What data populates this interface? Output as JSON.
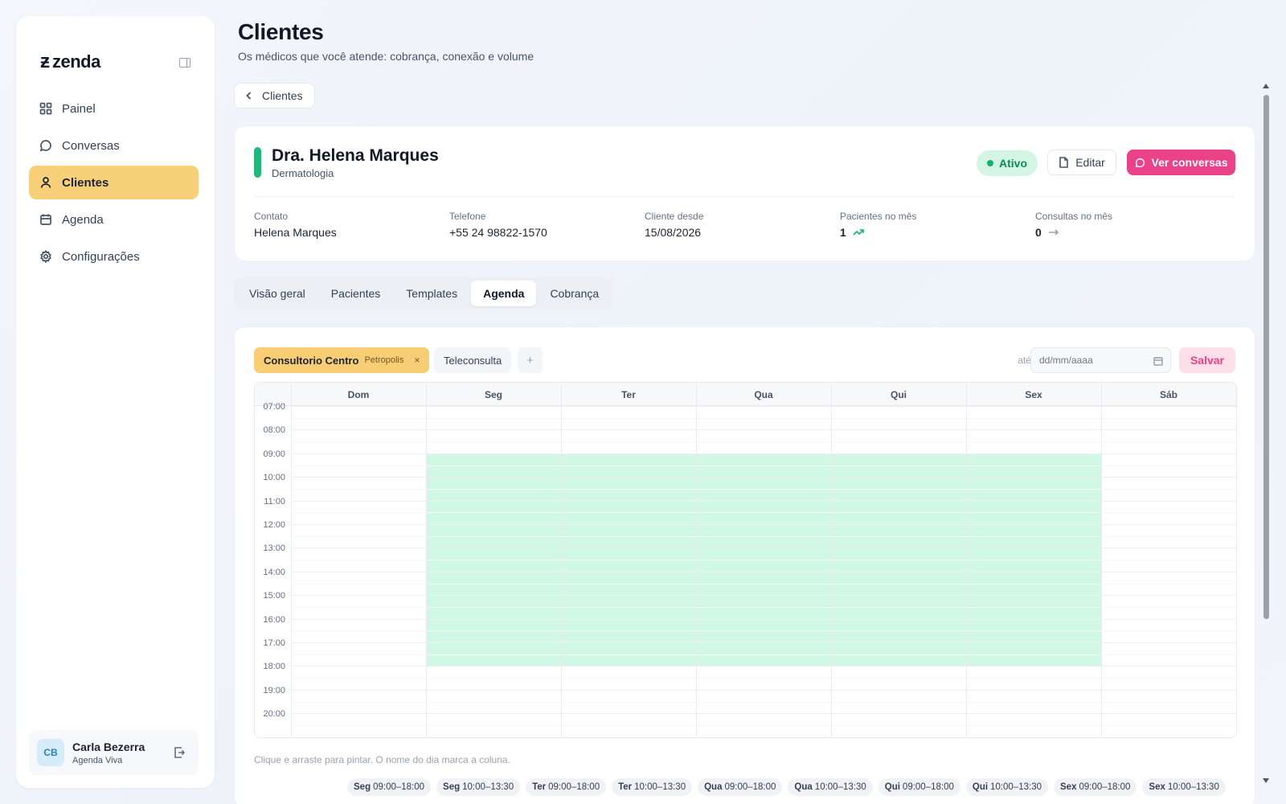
{
  "app": {
    "logo_text": "zenda"
  },
  "sidebar": {
    "items": [
      {
        "label": "Painel",
        "icon": "grid-icon"
      },
      {
        "label": "Conversas",
        "icon": "chat-icon"
      },
      {
        "label": "Clientes",
        "icon": "user-icon",
        "active": true
      },
      {
        "label": "Agenda",
        "icon": "calendar-icon"
      },
      {
        "label": "Configurações",
        "icon": "gear-icon"
      }
    ],
    "user": {
      "initials": "CB",
      "name": "Carla Bezerra",
      "subtitle": "Agenda Viva"
    }
  },
  "header": {
    "title": "Clientes",
    "subtitle": "Os médicos que você atende: cobrança, conexão e volume",
    "back_label": "Clientes"
  },
  "client": {
    "name": "Dra. Helena Marques",
    "specialty": "Dermatologia",
    "status": "Ativo",
    "edit_label": "Editar",
    "conversations_label": "Ver conversas",
    "accent_color": "#20b97b",
    "stats": [
      {
        "label": "Contato",
        "value": "Helena Marques"
      },
      {
        "label": "Telefone",
        "value": "+55 24 98822-1570"
      },
      {
        "label": "Cliente desde",
        "value": "15/08/2026"
      },
      {
        "label": "Pacientes no mês",
        "value": "1",
        "trend": "up"
      },
      {
        "label": "Consultas no mês",
        "value": "0",
        "trend": "flat"
      }
    ]
  },
  "tabs": [
    {
      "label": "Visão geral"
    },
    {
      "label": "Pacientes"
    },
    {
      "label": "Templates"
    },
    {
      "label": "Agenda",
      "active": true
    },
    {
      "label": "Cobrança"
    }
  ],
  "agenda": {
    "locations": [
      {
        "name": "Consultorio Centro",
        "city": "Petropolis",
        "active": true,
        "remove": "×"
      },
      {
        "name": "Teleconsulta"
      }
    ],
    "add_label": "+",
    "until_label": "até",
    "date_placeholder": "dd/mm/aaaa",
    "save_label": "Salvar",
    "days": [
      "Dom",
      "Seg",
      "Ter",
      "Qua",
      "Qui",
      "Sex",
      "Sáb"
    ],
    "hours": [
      "07:00",
      "08:00",
      "09:00",
      "10:00",
      "11:00",
      "12:00",
      "13:00",
      "14:00",
      "15:00",
      "16:00",
      "17:00",
      "18:00",
      "19:00",
      "20:00"
    ],
    "availability": {
      "days": [
        "Seg",
        "Ter",
        "Qua",
        "Qui",
        "Sex"
      ],
      "start": "09:00",
      "end": "18:00",
      "color": "#ccf7e1"
    },
    "hint": "Clique e arraste para pintar. O nome do dia marca a coluna.",
    "slots": [
      {
        "day": "Seg",
        "time": "09:00–18:00"
      },
      {
        "day": "Seg",
        "time": "10:00–13:30"
      },
      {
        "day": "Ter",
        "time": "09:00–18:00"
      },
      {
        "day": "Ter",
        "time": "10:00–13:30"
      },
      {
        "day": "Qua",
        "time": "09:00–18:00"
      },
      {
        "day": "Qua",
        "time": "10:00–13:30"
      },
      {
        "day": "Qui",
        "time": "09:00–18:00"
      },
      {
        "day": "Qui",
        "time": "10:00–13:30"
      },
      {
        "day": "Sex",
        "time": "09:00–18:00"
      },
      {
        "day": "Sex",
        "time": "10:00–13:30"
      }
    ]
  },
  "colors": {
    "accent": "#f8d07a",
    "primary": "#e94289",
    "success": "#17b26a"
  }
}
